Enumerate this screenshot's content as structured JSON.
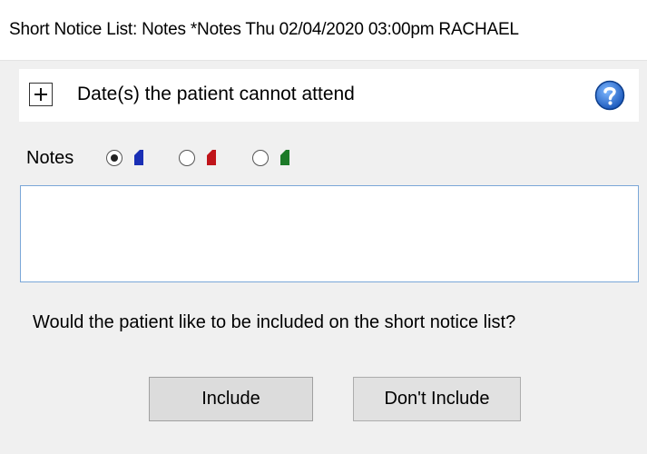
{
  "window": {
    "title": "Short Notice List: Notes *Notes Thu 02/04/2020 03:00pm RACHAEL"
  },
  "section": {
    "expand_icon": "plus-box-icon",
    "label": "Date(s) the patient cannot attend",
    "help_icon": "help-question-icon",
    "help_color": "#1e6fd9"
  },
  "notes": {
    "label": "Notes",
    "options": [
      {
        "color": "#1a2fb5",
        "selected": true
      },
      {
        "color": "#c0141a",
        "selected": false
      },
      {
        "color": "#1c7a28",
        "selected": false
      }
    ],
    "value": ""
  },
  "question": "Would the patient like to be included on the short notice list?",
  "buttons": {
    "include": "Include",
    "dont_include": "Don't Include"
  }
}
